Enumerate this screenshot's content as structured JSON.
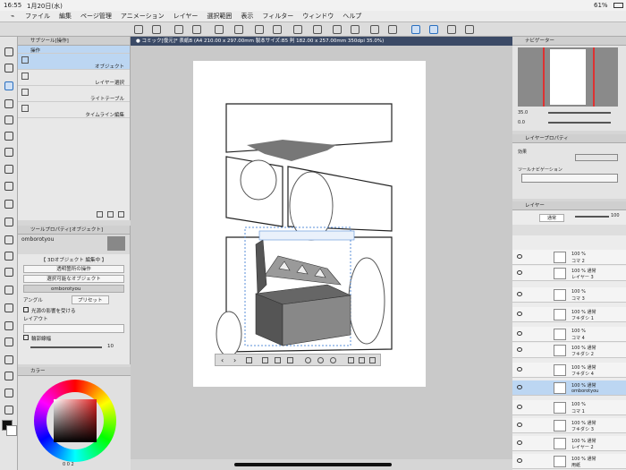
{
  "status": {
    "time": "16:55",
    "date": "1月20日(水)",
    "battery": "61%"
  },
  "menu": [
    "ファイル",
    "編集",
    "ページ管理",
    "アニメーション",
    "レイヤー",
    "選択範囲",
    "表示",
    "フィルター",
    "ウィンドウ",
    "ヘルプ"
  ],
  "canvas_tab": "● コミック[復元]* 表紙B (A4 210.00 x 297.00mm 製本サイズ:B5 判 182.00 x 257.00mm 350dpi 35.0%)",
  "subtool": {
    "header": "サブツール[操作]",
    "items": [
      "操作",
      "オブジェクト",
      "レイヤー選択",
      "ライトテーブル",
      "タイムライン編集"
    ]
  },
  "toolprop": {
    "header": "ツールプロパティ[オブジェクト]",
    "object_name": "omborotyou",
    "section": "【 3Dオブジェクト 編集中 】",
    "btn1": "透明箇所の操作",
    "btn2": "選択可能なオブジェクト",
    "item": "omborotyou",
    "angle": "アングル",
    "preset": "プリセット",
    "light": "光源の影響を受ける",
    "layout": "レイアウト",
    "outline": "輪郭線幅",
    "outline_val": "10"
  },
  "color": {
    "header": "カラー",
    "readout": "0 0 2"
  },
  "navigator": {
    "header": "ナビゲーター",
    "zoom": "35.0",
    "angle": "0.0"
  },
  "layerprop": {
    "header": "レイヤープロパティ",
    "effect": "効果",
    "ruler": "ツールナビゲーション"
  },
  "layers": {
    "header": "レイヤー",
    "blend": "通常",
    "opacity": "100",
    "rows": [
      {
        "pct": "100 %",
        "name": "コマ 2"
      },
      {
        "pct": "100 % 通常",
        "name": "レイヤー 3"
      },
      {
        "pct": "100 %",
        "name": "コマ 3"
      },
      {
        "pct": "100 % 通常",
        "name": "フキダシ 1"
      },
      {
        "pct": "100 %",
        "name": "コマ 4"
      },
      {
        "pct": "100 % 通常",
        "name": "フキダシ 2"
      },
      {
        "pct": "100 % 通常",
        "name": "フキダシ 4"
      },
      {
        "pct": "100 % 通常",
        "name": "omborotyou"
      },
      {
        "pct": "100 %",
        "name": "コマ 1"
      },
      {
        "pct": "100 % 通常",
        "name": "フキダシ 3"
      },
      {
        "pct": "100 % 通常",
        "name": "レイヤー 2"
      },
      {
        "pct": "100 % 通常",
        "name": "用紙"
      }
    ]
  }
}
